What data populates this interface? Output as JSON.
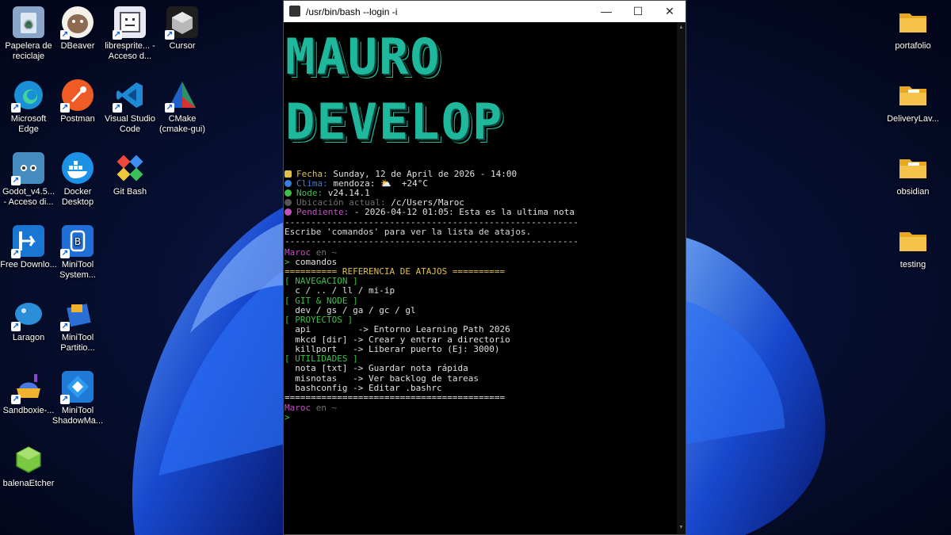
{
  "desktop": {
    "icons": [
      {
        "label": "Papelera de reciclaje",
        "icon": "recycle-bin-icon",
        "color": "#8aa6c8"
      },
      {
        "label": "DBeaver",
        "icon": "dbeaver-icon",
        "color": "#8c6b52"
      },
      {
        "label": "librespritе... - Acceso d...",
        "icon": "libresprite-icon",
        "color": "#d0d0e0"
      },
      {
        "label": "Cursor",
        "icon": "cursor-icon",
        "color": "#2a2a2a"
      },
      {
        "label": "Microsoft Edge",
        "icon": "edge-icon",
        "color": "#1b8fd6"
      },
      {
        "label": "Postman",
        "icon": "postman-icon",
        "color": "#ef5b25"
      },
      {
        "label": "Visual Studio Code",
        "icon": "vscode-icon",
        "color": "#1e8ad6"
      },
      {
        "label": "CMake (cmake-gui)",
        "icon": "cmake-icon",
        "color": "#2f8f6b"
      },
      {
        "label": "Godot_v4.5... - Acceso di...",
        "icon": "godot-icon",
        "color": "#478cbf"
      },
      {
        "label": "Docker Desktop",
        "icon": "docker-icon",
        "color": "#1d91e6"
      },
      {
        "label": "Git Bash",
        "icon": "git-bash-icon",
        "color": "#f0483c"
      },
      {
        "label": "Free Downlo...",
        "icon": "free-download-icon",
        "color": "#1976d2"
      },
      {
        "label": "MiniTool System...",
        "icon": "minitool-system-icon",
        "color": "#1f6fd6"
      },
      {
        "label": "Laragon",
        "icon": "laragon-icon",
        "color": "#2a8fd8"
      },
      {
        "label": "MiniTool Partitio...",
        "icon": "minitool-partition-icon",
        "color": "#e0a020"
      },
      {
        "label": "Sandboxie-...",
        "icon": "sandboxie-icon",
        "color": "#f0b030"
      },
      {
        "label": "MiniTool ShadowMa...",
        "icon": "minitool-shadowmaker-icon",
        "color": "#1f7ad6"
      },
      {
        "label": "balenaEtcher",
        "icon": "balena-etcher-icon",
        "color": "#7ac943"
      },
      {
        "label": "portafolio",
        "icon": "folder-icon",
        "color": "#f5c24a"
      },
      {
        "label": "DeliveryLav...",
        "icon": "folder-icon",
        "color": "#f5c24a"
      },
      {
        "label": "obsidian",
        "icon": "folder-icon",
        "color": "#f5c24a"
      },
      {
        "label": "testing",
        "icon": "folder-icon",
        "color": "#f5c24a"
      }
    ]
  },
  "terminal": {
    "title": "/usr/bin/bash --login -i",
    "buttons": {
      "minimize": "—",
      "maximize": "☐",
      "close": "✕"
    },
    "banner": [
      "MAURO",
      "DEVELOP"
    ],
    "info": {
      "fecha_label": "Fecha:",
      "fecha_value": "Sunday, 12 de April de 2026 - 14:00",
      "clima_label": "Clima:",
      "clima_value": "mendoza: ⛅  +24°C",
      "node_label": "Node:",
      "node_value": "v24.14.1",
      "ubic_label": "Ubicación actual:",
      "ubic_value": "/c/Users/Maroc",
      "pend_label": "Pendiente:",
      "pend_value": "- 2026-04-12 01:05: Esta es la ultima nota"
    },
    "separator": "--------------------------------------------------------",
    "hint": "Escribe 'comandos' para ver la lista de atajos.",
    "prompt_user": "Maroc",
    "prompt_en": "en ~",
    "prompt_char": ">",
    "command": "comandos",
    "ref_header": "========== REFERENCIA DE ATAJOS ==========",
    "sec_nav": "[ NAVEGACION ]",
    "nav_line": "  c / .. / ll / mi-ip",
    "sec_git": "[ GIT & NODE ]",
    "git_line": "  dev / gs / ga / gc / gl",
    "sec_proy": "[ PROYECTOS ]",
    "proy_1": "  api         -> Entorno Learning Path 2026",
    "proy_2": "  mkcd [dir] -> Crear y entrar a directorio",
    "proy_3": "  killport   -> Liberar puerto (Ej: 3000)",
    "sec_util": "[ UTILIDADES ]",
    "util_1": "  nota [txt] -> Guardar nota rápida",
    "util_2": "  misnotas   -> Ver backlog de tareas",
    "util_3": "  bashconfig -> Editar .bashrc",
    "ref_footer": "=========================================="
  }
}
